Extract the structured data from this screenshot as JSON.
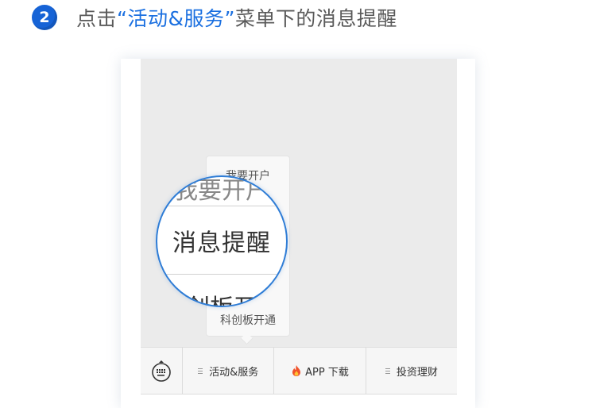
{
  "step": {
    "number": "2",
    "text_prefix": "点击",
    "text_highlight": "“活动&服务”",
    "text_suffix": "菜单下的消息提醒"
  },
  "popup": {
    "top_item": "我要开户",
    "bottom_item": "科创板开通"
  },
  "magnifier": {
    "main_text": "消息提醒",
    "partial_top": "我要开户",
    "partial_bottom": "创板开"
  },
  "menubar": {
    "keyboard_icon": "keyboard-icon",
    "items": [
      {
        "label": "活动&服务",
        "icon": "menu-lines-icon"
      },
      {
        "label": "APP 下载",
        "icon": "fire-icon"
      },
      {
        "label": "投资理财",
        "icon": "menu-lines-icon"
      }
    ]
  },
  "colors": {
    "accent": "#1663d6",
    "highlight_text": "#1a6fe0",
    "magnifier_border": "#2f7dd6",
    "screen_bg": "#ebebeb"
  }
}
